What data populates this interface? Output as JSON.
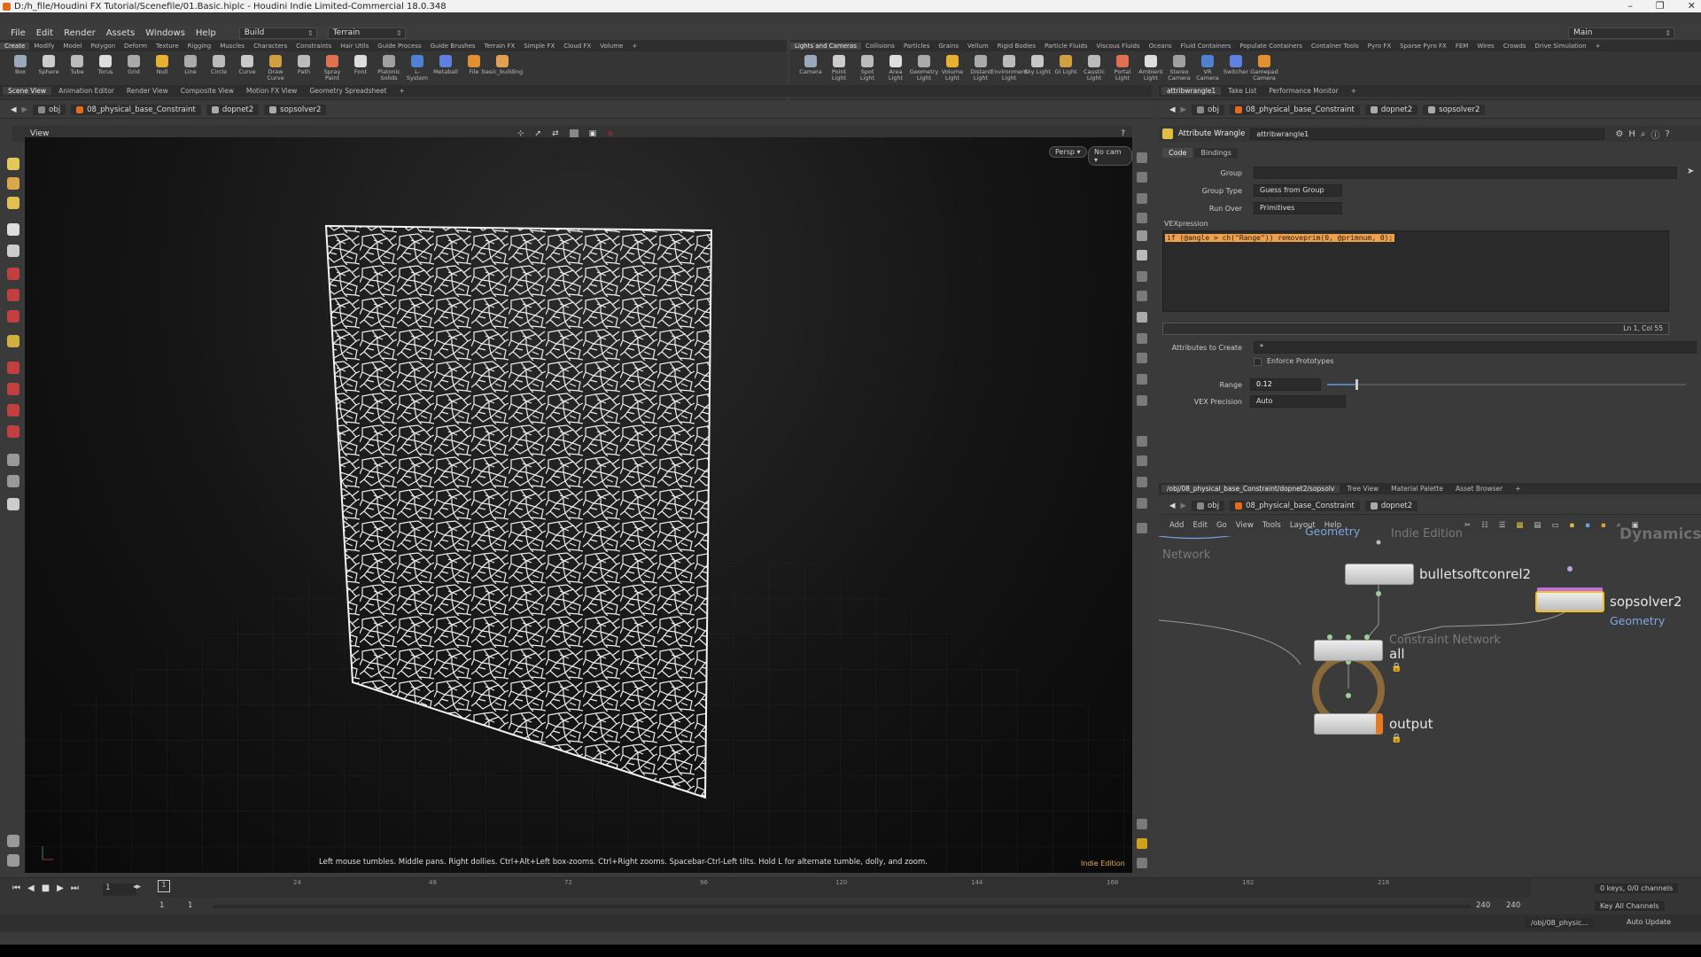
{
  "window": {
    "title": "D:/h_file/Houdini FX Tutorial/Scenefile/01.Basic.hiplc - Houdini Indie Limited-Commercial 18.0.348",
    "minimize": "–",
    "maximize": "❐",
    "close": "✕"
  },
  "menu": {
    "items": [
      "File",
      "Edit",
      "Render",
      "Assets",
      "Windows",
      "Help"
    ],
    "desktop": "Build",
    "terrain": "Terrain",
    "main": "Main"
  },
  "shelf_left": {
    "tabs": [
      "Create",
      "Modify",
      "Model",
      "Polygon",
      "Deform",
      "Texture",
      "Rigging",
      "Muscles",
      "Characters",
      "Constraints",
      "Hair Utils",
      "Guide Process",
      "Guide Brushes",
      "Terrain FX",
      "Simple FX",
      "Cloud FX",
      "Volume",
      "+"
    ],
    "tools": [
      "Box",
      "Sphere",
      "Tube",
      "Torus",
      "Grid",
      "Null",
      "Line",
      "Circle",
      "Curve",
      "Draw Curve",
      "Path",
      "Spray Paint",
      "Font",
      "Platonic Solids",
      "L-System",
      "Metaball",
      "File",
      "basic_building"
    ]
  },
  "shelf_right": {
    "tabs": [
      "Lights and Cameras",
      "Collisions",
      "Particles",
      "Grains",
      "Vellum",
      "Rigid Bodies",
      "Particle Fluids",
      "Viscous Fluids",
      "Oceans",
      "Fluid Containers",
      "Populate Containers",
      "Container Tools",
      "Pyro FX",
      "Sparse Pyro FX",
      "FEM",
      "Wires",
      "Crowds",
      "Drive Simulation",
      "+"
    ],
    "tools": [
      "Camera",
      "Point Light",
      "Spot Light",
      "Area Light",
      "Geometry Light",
      "Volume Light",
      "Distant Light",
      "Environment Light",
      "Sky Light",
      "GI Light",
      "Caustic Light",
      "Portal Light",
      "Ambient Light",
      "Stereo Camera",
      "VR Camera",
      "Switcher",
      "Gamepad Camera"
    ]
  },
  "left_pane_tabs": [
    "Scene View",
    "Animation Editor",
    "Render View",
    "Composite View",
    "Motion FX View",
    "Geometry Spreadsheet",
    "+"
  ],
  "left_path": {
    "root": "obj",
    "items": [
      "08_physical_base_Constraint",
      "dopnet2",
      "sopsolver2"
    ]
  },
  "viewport": {
    "header": "View",
    "persp": "Persp ▾",
    "cam": "No cam ▾",
    "hint": "Left mouse tumbles. Middle pans. Right dollies. Ctrl+Alt+Left box-zooms. Ctrl+Right zooms. Spacebar-Ctrl-Left tilts. Hold L for alternate tumble, dolly, and zoom.",
    "indie": "Indie Edition"
  },
  "right_pane_tabs": [
    "attribwrangle1",
    "Take List",
    "Performance Monitor",
    "+"
  ],
  "right_path": {
    "root": "obj",
    "items": [
      "08_physical_base_Constraint",
      "dopnet2",
      "sopsolver2"
    ]
  },
  "params": {
    "node_type": "Attribute Wrangle",
    "node_name": "attribwrangle1",
    "tabs": [
      "Code",
      "Bindings"
    ],
    "group_label": "Group",
    "group_value": "",
    "group_type_label": "Group Type",
    "group_type_value": "Guess from Group",
    "run_over_label": "Run Over",
    "run_over_value": "Primitives",
    "vex_label": "VEXpression",
    "vex_code": "if (@angle > ch(\"Range\"))  removeprim(0, @primnum, 0);",
    "cursor_pos": "Ln 1, Col 55",
    "attrs_label": "Attributes to Create",
    "attrs_value": "*",
    "enforce_label": "Enforce Prototypes",
    "range_label": "Range",
    "range_value": "0.12",
    "range_fraction": 0.12,
    "precision_label": "VEX Precision",
    "precision_value": "Auto"
  },
  "network_tabs": [
    "/obj/08_physical_base_Constraint/dopnet2/sopsolv",
    "Tree View",
    "Material Palette",
    "Asset Browser",
    "+"
  ],
  "network_path": {
    "root": "obj",
    "items": [
      "08_physical_base_Constraint",
      "dopnet2"
    ]
  },
  "network_menu": [
    "Add",
    "Edit",
    "Go",
    "View",
    "Tools",
    "Layout",
    "Help"
  ],
  "network": {
    "context_geometry": "Geometry",
    "watermark_indie": "Indie Edition",
    "watermark_dynamics": "Dynamics",
    "network_label": "Network",
    "nodes": {
      "bullet": "bulletsoftconrel2",
      "sopsolver": "sopsolver2",
      "sopsolver_sub": "Geometry",
      "constraint_sub": "Constraint Network",
      "all": "all",
      "output": "output"
    }
  },
  "timeline": {
    "current_frame": "1",
    "frame_field": "1",
    "ticks": [
      "24",
      "48",
      "72",
      "96",
      "120",
      "144",
      "168",
      "192",
      "216"
    ],
    "start1": "1",
    "start2": "1",
    "end1": "240",
    "end2": "240",
    "keys_info": "0 keys, 0/0 channels",
    "key_all": "Key All Channels"
  },
  "status": {
    "path": "/obj/08_physic...",
    "auto_update": "Auto Update"
  },
  "colors": {
    "houdini_orange": "#e36b1c",
    "selection_yellow": "#f0c020",
    "node_blue": "#7ea7e3",
    "vex_highlight": "#f0a04a"
  }
}
